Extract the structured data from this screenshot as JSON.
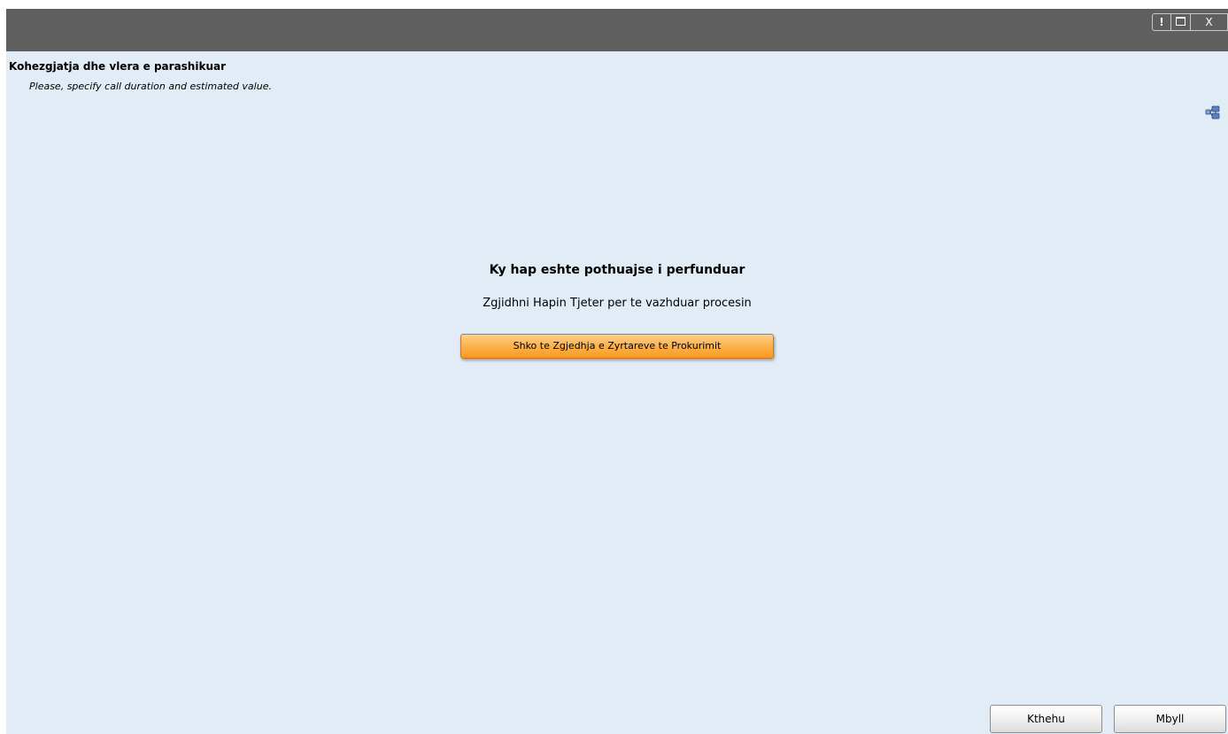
{
  "window": {
    "controls": {
      "help_label": "!",
      "close_label": "X"
    }
  },
  "header": {
    "title": "Kohezgjatja dhe vlera e parashikuar",
    "subtitle": "Please, specify call duration and estimated value."
  },
  "toolbar": {
    "icon": "network-icon"
  },
  "main": {
    "message_title": "Ky hap eshte pothuajse i perfunduar",
    "message_subtitle": "Zgjidhni Hapin Tjeter per te vazhduar procesin",
    "next_step_button": "Shko te Zgjedhja e Zyrtareve te Prokurimit"
  },
  "footer": {
    "back_label": "Kthehu",
    "close_label": "Mbyll"
  },
  "colors": {
    "titlebar": "#5f5f5f",
    "background": "#e1ecf7",
    "accent_button": "#fdb450"
  }
}
